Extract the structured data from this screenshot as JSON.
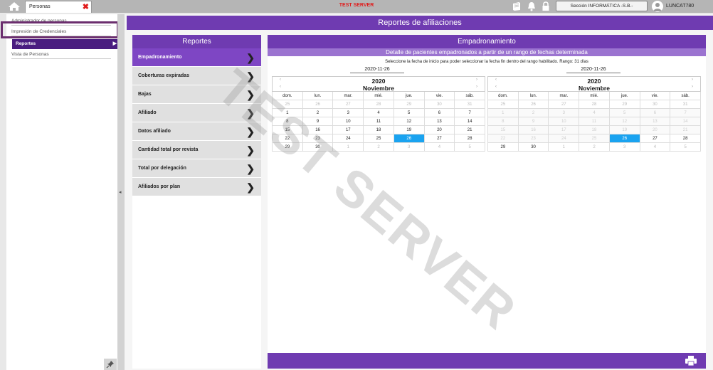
{
  "topbar": {
    "tab_label": "Personas",
    "tab_close": "✖",
    "server_label": "TEST SERVER",
    "section_select": "Sección INFORMÁTICA -S.B.-",
    "username": "LUNCAT780"
  },
  "sidebar": {
    "items": [
      {
        "label": "Administrador de personas"
      },
      {
        "label": "Impresión de Credenciales"
      },
      {
        "label": "Reportes"
      },
      {
        "label": "Vista de Personas"
      }
    ],
    "active_arrow": "▶"
  },
  "main": {
    "title": "Reportes de afiliaciones"
  },
  "reports": {
    "header": "Reportes",
    "items": [
      {
        "label": "Empadronamiento"
      },
      {
        "label": "Coberturas expiradas"
      },
      {
        "label": "Bajas"
      },
      {
        "label": "Afiliado"
      },
      {
        "label": "Datos afiliado"
      },
      {
        "label": "Cantidad total por revista"
      },
      {
        "label": "Total por delegación"
      },
      {
        "label": "Afiliados por plan"
      }
    ]
  },
  "empadronamiento": {
    "header": "Empadronamiento",
    "subtitle": "Detalle de pacientes empadronados a partir de un rango de fechas determinada",
    "instruction": "Seleccione la fecha de inicio para poder seleccionar la fecha fin dentro del rango habilitado. Rango: 31 días",
    "start_date": "2020-11-26",
    "end_date": "2020-11-26"
  },
  "calendar": {
    "year": "2020",
    "month": "Noviembre",
    "weekdays": [
      "dom.",
      "lun.",
      "mar.",
      "mié.",
      "jue.",
      "vie.",
      "sáb."
    ],
    "days": [
      "25",
      "26",
      "27",
      "28",
      "29",
      "30",
      "31",
      "1",
      "2",
      "3",
      "4",
      "5",
      "6",
      "7",
      "8",
      "9",
      "10",
      "11",
      "12",
      "13",
      "14",
      "15",
      "16",
      "17",
      "18",
      "19",
      "20",
      "21",
      "22",
      "23",
      "24",
      "25",
      "26",
      "27",
      "28",
      "29",
      "30",
      "1",
      "2",
      "3",
      "4",
      "5"
    ],
    "nav_prev": "‹",
    "nav_next": "›"
  },
  "watermark": "TEST SERVER",
  "icons": {
    "home": "home-icon",
    "book": "book-icon",
    "bell": "bell-icon",
    "lock": "lock-icon",
    "user": "user-icon",
    "pin": "pin-icon",
    "print": "printer-icon"
  },
  "colors": {
    "primary": "#6f3bb1",
    "dark_primary": "#4a1d80",
    "active_item": "#7e46c4",
    "today": "#1aa3f0",
    "server_red": "#e01b1b"
  }
}
